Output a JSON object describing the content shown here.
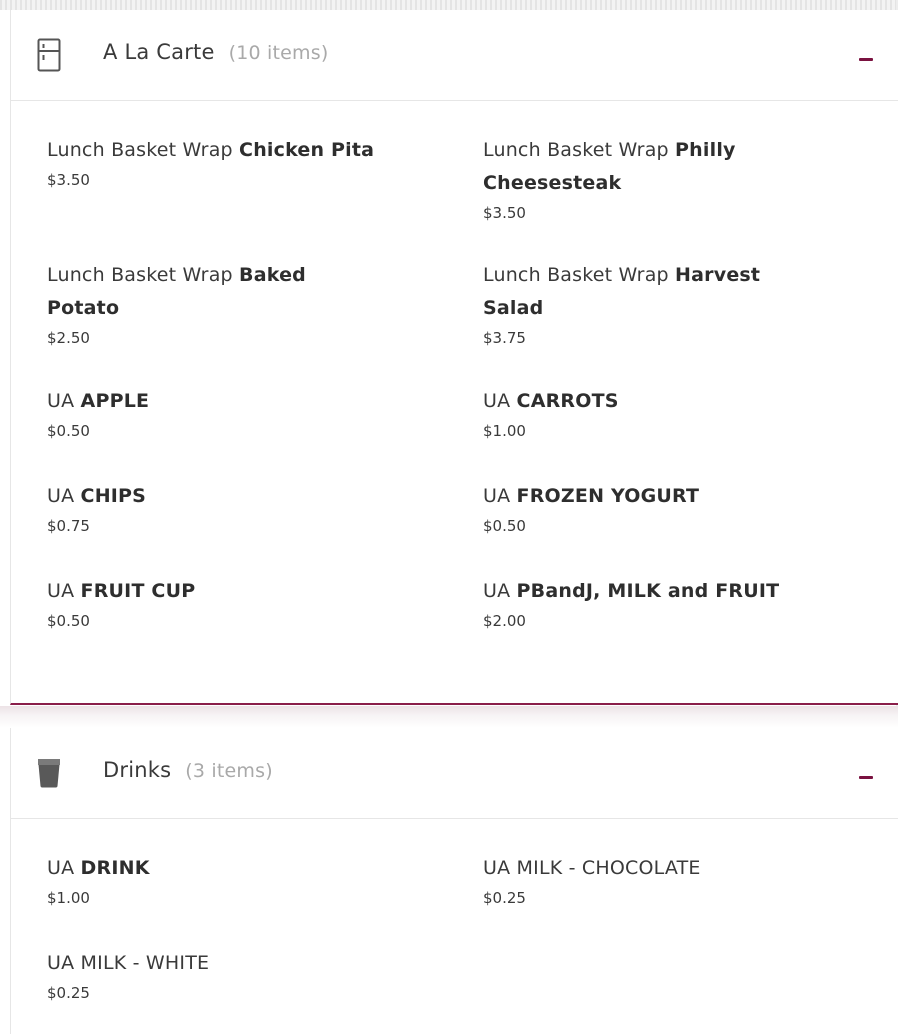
{
  "sections": [
    {
      "title": "A La Carte",
      "count": "(10 items)",
      "icon": "locker-icon",
      "items": [
        {
          "prefix": "Lunch Basket Wrap ",
          "name": "Chicken Pita",
          "price": "$3.50"
        },
        {
          "prefix": "Lunch Basket Wrap ",
          "name": "Philly Cheesesteak",
          "price": "$3.50"
        },
        {
          "prefix": "Lunch Basket Wrap ",
          "name": "Baked Potato",
          "price": "$2.50"
        },
        {
          "prefix": "Lunch Basket Wrap ",
          "name": "Harvest Salad",
          "price": "$3.75"
        },
        {
          "prefix": "UA ",
          "name": "APPLE",
          "price": "$0.50"
        },
        {
          "prefix": "UA ",
          "name": "CARROTS",
          "price": "$1.00"
        },
        {
          "prefix": "UA ",
          "name": "CHIPS",
          "price": "$0.75"
        },
        {
          "prefix": "UA ",
          "name": "FROZEN YOGURT",
          "price": "$0.50"
        },
        {
          "prefix": "UA ",
          "name": "FRUIT CUP",
          "price": "$0.50"
        },
        {
          "prefix": "UA ",
          "name": "PBandJ, MILK and FRUIT",
          "price": "$2.00"
        }
      ]
    },
    {
      "title": "Drinks",
      "count": "(3 items)",
      "icon": "cup-icon",
      "items": [
        {
          "prefix": "UA ",
          "name": "DRINK",
          "price": "$1.00"
        },
        {
          "prefix": "UA MILK - CHOCOLATE",
          "name": "",
          "price": "$0.25"
        },
        {
          "prefix": "UA MILK - WHITE",
          "name": "",
          "price": "$0.25"
        }
      ]
    }
  ],
  "colors": {
    "accent": "#7a1240",
    "divider": "#8a1e4a",
    "text": "#3a3a3a",
    "muted": "#a9a9a9"
  }
}
